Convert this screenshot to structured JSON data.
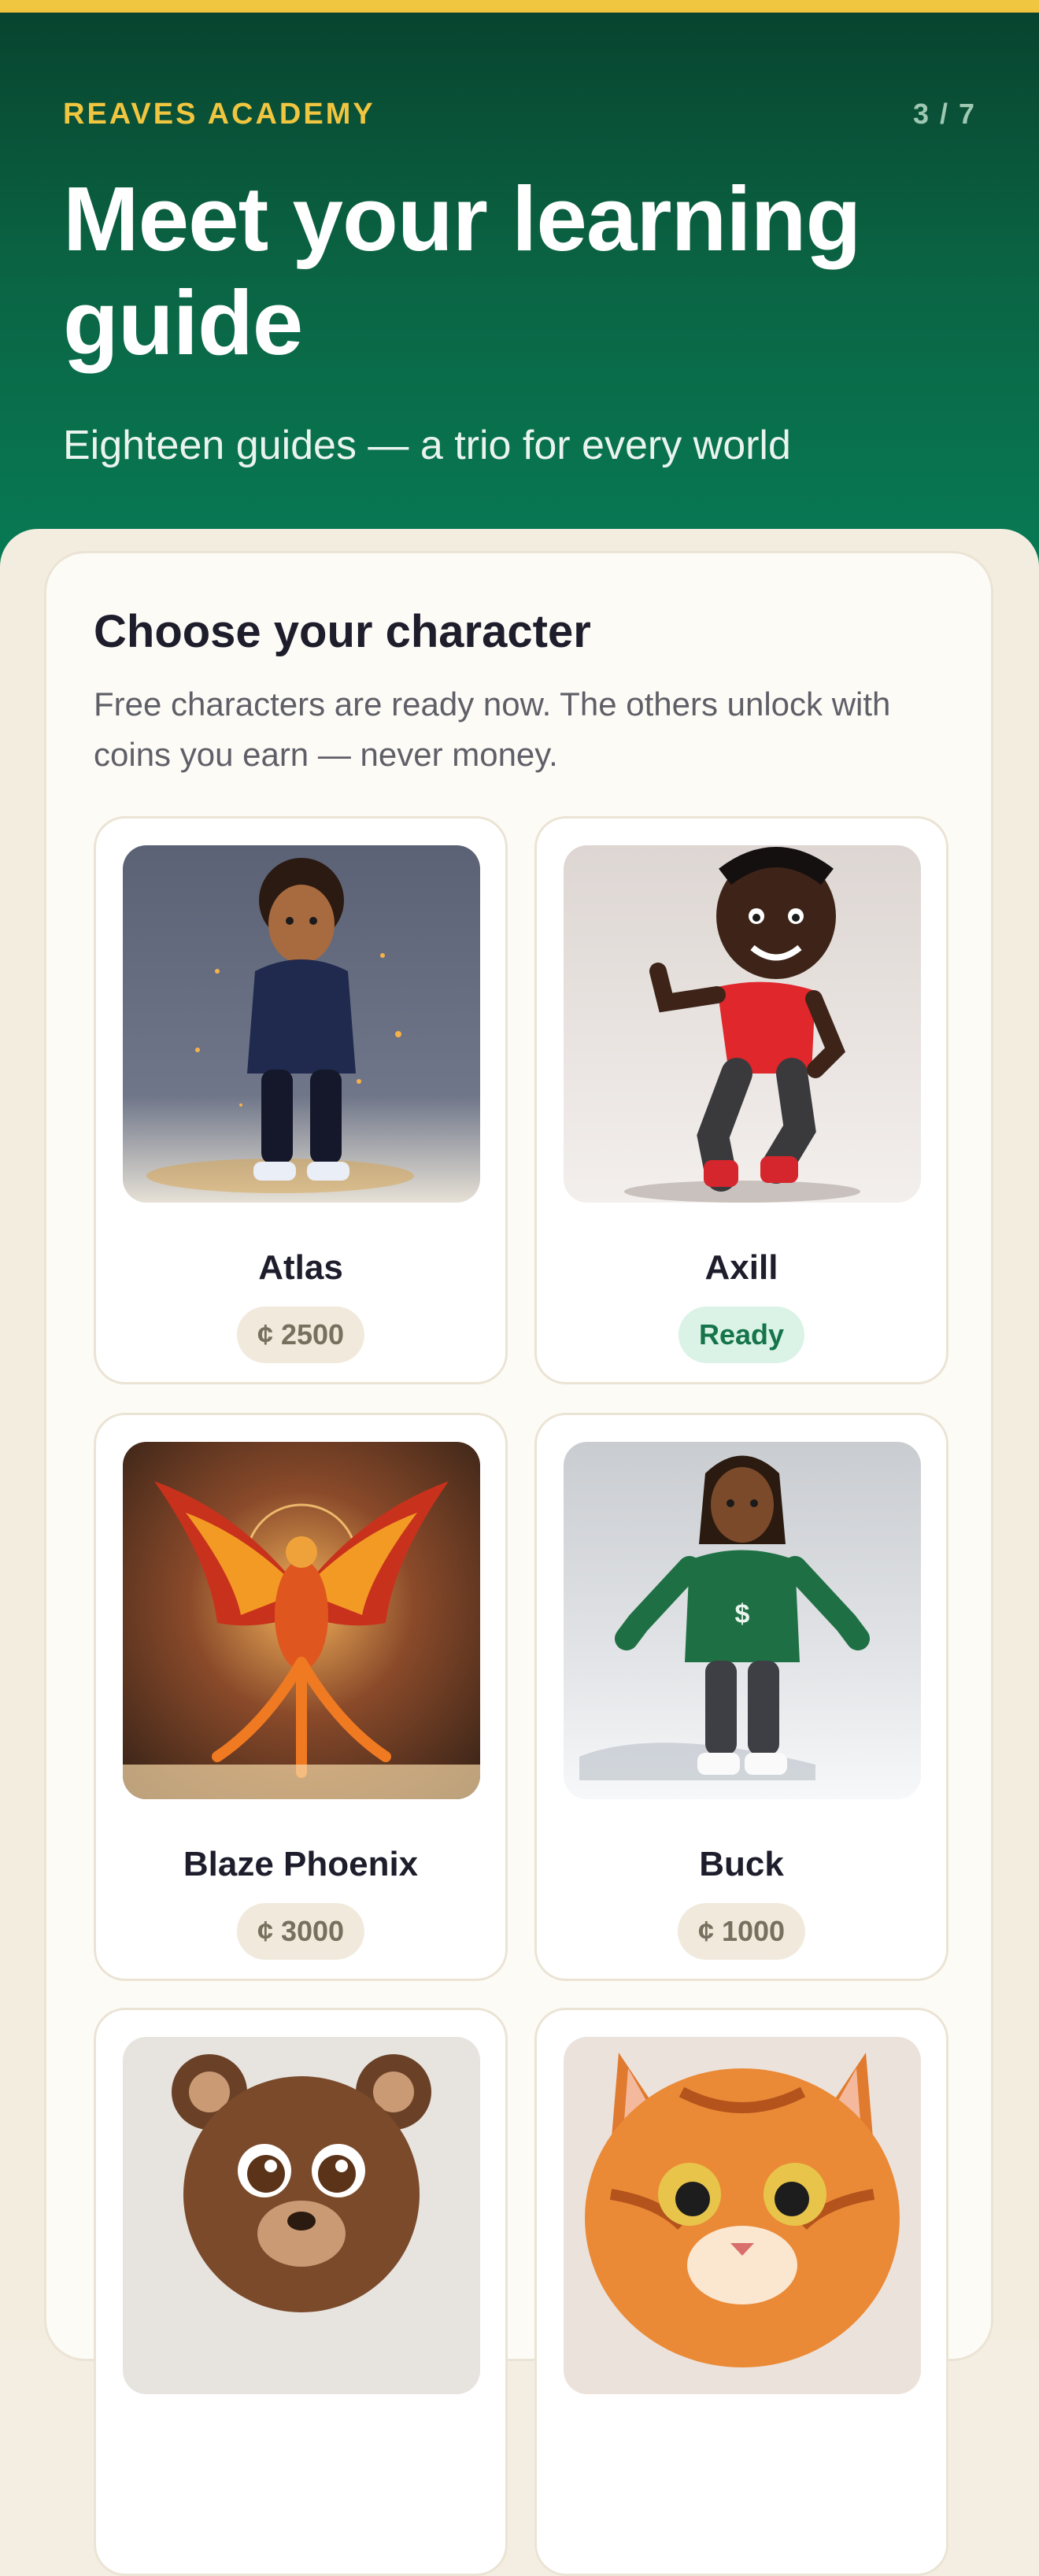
{
  "header": {
    "brand": "REAVES ACADEMY",
    "step": "3 / 7",
    "title": "Meet your learning guide",
    "subtitle": "Eighteen guides — a trio for every world"
  },
  "panel": {
    "title": "Choose your character",
    "description": "Free characters are ready now. The others unlock with coins you earn — never money."
  },
  "characters": [
    {
      "name": "Atlas",
      "badge": "¢ 2500",
      "status": "locked",
      "image": "boy-navy-hoodie"
    },
    {
      "name": "Axill",
      "badge": "Ready",
      "status": "ready",
      "image": "boy-red-shirt-running"
    },
    {
      "name": "Blaze Phoenix",
      "badge": "¢ 3000",
      "status": "locked",
      "image": "fire-phoenix"
    },
    {
      "name": "Buck",
      "badge": "¢ 1000",
      "status": "locked",
      "image": "boy-green-hoodie"
    },
    {
      "name": "",
      "badge": "",
      "status": "",
      "image": "brown-bear-cub"
    },
    {
      "name": "",
      "badge": "",
      "status": "",
      "image": "orange-tabby-cat"
    }
  ],
  "colors": {
    "accent": "#f0c53f",
    "hero_dark": "#08442f",
    "hero_light": "#087b55",
    "ready_bg": "#daf3e6",
    "ready_text": "#15744a",
    "price_bg": "#f1eadc"
  }
}
